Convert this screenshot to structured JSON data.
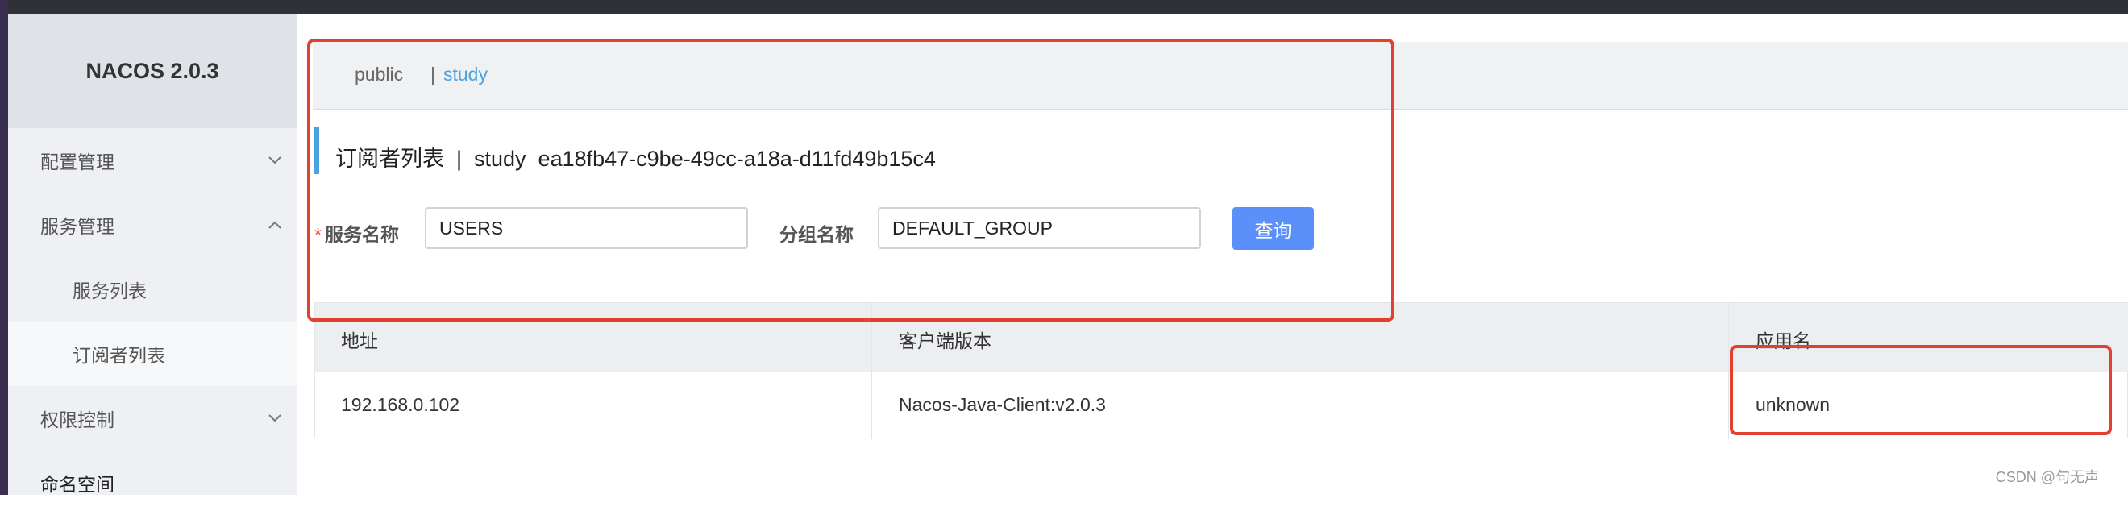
{
  "app": {
    "brand": "NACOS 2.0.3"
  },
  "sidebar": {
    "items": [
      {
        "label": "配置管理",
        "chevron": "down"
      },
      {
        "label": "服务管理",
        "chevron": "up"
      },
      {
        "label": "服务列表"
      },
      {
        "label": "订阅者列表",
        "active": true
      },
      {
        "label": "权限控制",
        "chevron": "down"
      },
      {
        "label": "命名空间"
      }
    ]
  },
  "namespaces": {
    "items": [
      "public",
      "study"
    ],
    "separator": "|",
    "selected": "study"
  },
  "page": {
    "title": "订阅者列表  |  study  ea18fb47-c9be-49cc-a18a-d11fd49b15c4"
  },
  "form": {
    "required_mark": "*",
    "service_label": "服务名称",
    "service_value": "USERS",
    "group_label": "分组名称",
    "group_value": "DEFAULT_GROUP",
    "query_button": "查询"
  },
  "table": {
    "columns": [
      "地址",
      "客户端版本",
      "应用名"
    ],
    "rows": [
      [
        "192.168.0.102",
        "Nacos-Java-Client:v2.0.3",
        "unknown"
      ]
    ]
  },
  "watermark": "CSDN @句无声",
  "colors": {
    "accent": "#4aa3df",
    "button": "#5b8ff9",
    "highlight": "#e2412f"
  }
}
